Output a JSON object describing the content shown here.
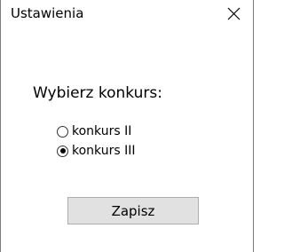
{
  "window": {
    "title": "Ustawienia",
    "close_icon": "close-icon"
  },
  "form": {
    "prompt": "Wybierz konkurs:",
    "options": [
      {
        "label": "konkurs II",
        "checked": false
      },
      {
        "label": "konkurs III",
        "checked": true
      }
    ],
    "save_label": "Zapisz"
  },
  "colors": {
    "window_background": "#ffffff",
    "button_background": "#e1e1e1",
    "button_border": "#adadad",
    "text": "#000000"
  }
}
